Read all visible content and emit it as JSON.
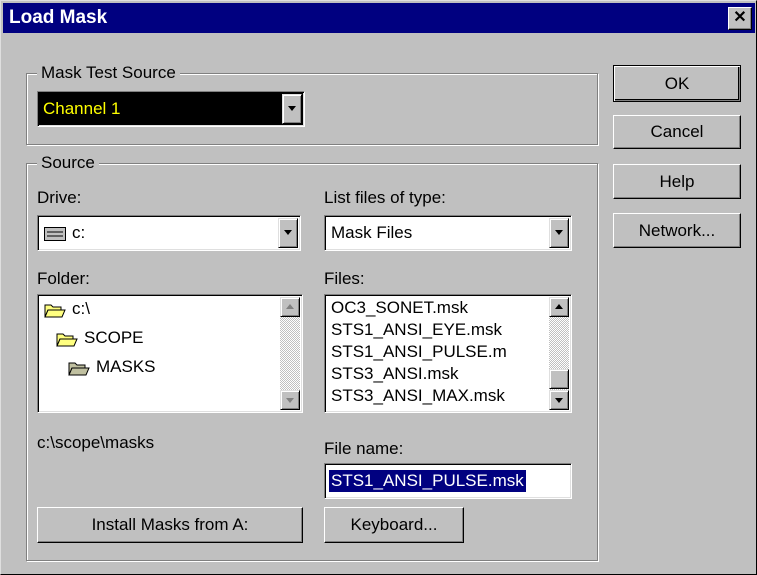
{
  "window": {
    "title": "Load Mask",
    "close_glyph": "✕"
  },
  "mask_test_source": {
    "group_label": "Mask Test Source",
    "selected": "Channel 1",
    "text_color": "#ffff00",
    "bg_color": "#000000"
  },
  "source": {
    "group_label": "Source",
    "drive_label": "Drive:",
    "drive_value": "c:",
    "file_type_label": "List files of type:",
    "file_type_value": "Mask Files",
    "folder_label": "Folder:",
    "folders": [
      {
        "name": "c:\\",
        "icon": "open-folder-icon"
      },
      {
        "name": "SCOPE",
        "icon": "open-folder-icon"
      },
      {
        "name": "MASKS",
        "icon": "open-folder-icon"
      }
    ],
    "files_label": "Files:",
    "files": [
      "OC3_SONET.msk",
      "STS1_ANSI_EYE.msk",
      "STS1_ANSI_PULSE.m",
      "STS3_ANSI.msk",
      "STS3_ANSI_MAX.msk"
    ],
    "current_path": "c:\\scope\\masks",
    "file_name_label": "File name:",
    "file_name_value": "STS1_ANSI_PULSE.msk",
    "install_button": "Install Masks from A:",
    "keyboard_button": "Keyboard..."
  },
  "buttons": {
    "ok": "OK",
    "cancel": "Cancel",
    "help": "Help",
    "network": "Network..."
  },
  "colors": {
    "titlebar": "#000080",
    "face": "#c0c0c0",
    "selection": "#000080",
    "folder": "#ffff80"
  }
}
